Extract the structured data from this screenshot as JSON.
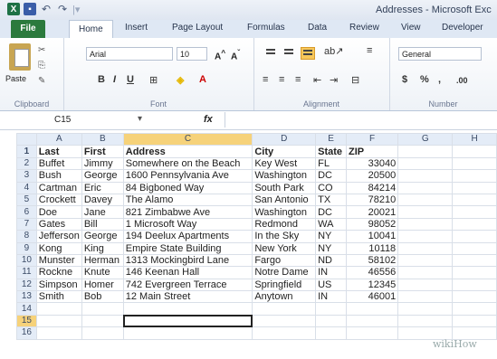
{
  "window": {
    "title": "Addresses - Microsoft Exc"
  },
  "ribbon_tabs": [
    "File",
    "Home",
    "Insert",
    "Page Layout",
    "Formulas",
    "Data",
    "Review",
    "View",
    "Developer"
  ],
  "ribbon": {
    "clipboard_label": "Clipboard",
    "paste_label": "Paste",
    "font_name": "Arial",
    "font_size": "10",
    "font_label": "Font",
    "alignment_label": "Alignment",
    "number_format": "General",
    "number_label": "Number"
  },
  "formula_bar": {
    "name_box": "C15",
    "fx": "fx",
    "value": ""
  },
  "columns": [
    "A",
    "B",
    "C",
    "D",
    "E",
    "F",
    "G",
    "H"
  ],
  "rows": [
    [
      "Last",
      "First",
      "Address",
      "City",
      "State",
      "ZIP",
      "",
      ""
    ],
    [
      "Buffet",
      "Jimmy",
      "Somewhere on the Beach",
      "Key West",
      "FL",
      "33040",
      "",
      ""
    ],
    [
      "Bush",
      "George",
      "1600 Pennsylvania Ave",
      "Washington",
      "DC",
      "20500",
      "",
      ""
    ],
    [
      "Cartman",
      "Eric",
      "84 Bigboned Way",
      "South Park",
      "CO",
      "84214",
      "",
      ""
    ],
    [
      "Crockett",
      "Davey",
      "The Alamo",
      "San Antonio",
      "TX",
      "78210",
      "",
      ""
    ],
    [
      "Doe",
      "Jane",
      "821 Zimbabwe Ave",
      "Washington",
      "DC",
      "20021",
      "",
      ""
    ],
    [
      "Gates",
      "Bill",
      "1 Microsoft Way",
      "Redmond",
      "WA",
      "98052",
      "",
      ""
    ],
    [
      "Jefferson",
      "George",
      "194 Deelux Apartments",
      "In the Sky",
      "NY",
      "10041",
      "",
      ""
    ],
    [
      "Kong",
      "King",
      "Empire State Building",
      "New York",
      "NY",
      "10118",
      "",
      ""
    ],
    [
      "Munster",
      "Herman",
      "1313 Mockingbird Lane",
      "Fargo",
      "ND",
      "58102",
      "",
      ""
    ],
    [
      "Rockne",
      "Knute",
      "146 Keenan Hall",
      "Notre Dame",
      "IN",
      "46556",
      "",
      ""
    ],
    [
      "Simpson",
      "Homer",
      "742 Evergreen Terrace",
      "Springfield",
      "US",
      "12345",
      "",
      ""
    ],
    [
      "Smith",
      "Bob",
      "12 Main Street",
      "Anytown",
      "IN",
      "46001",
      "",
      ""
    ],
    [
      "",
      "",
      "",
      "",
      "",
      "",
      "",
      ""
    ],
    [
      "",
      "",
      "",
      "",
      "",
      "",
      "",
      ""
    ],
    [
      "",
      "",
      "",
      "",
      "",
      "",
      "",
      ""
    ]
  ],
  "selected_cell": "C15",
  "watermark": "wikiHow"
}
